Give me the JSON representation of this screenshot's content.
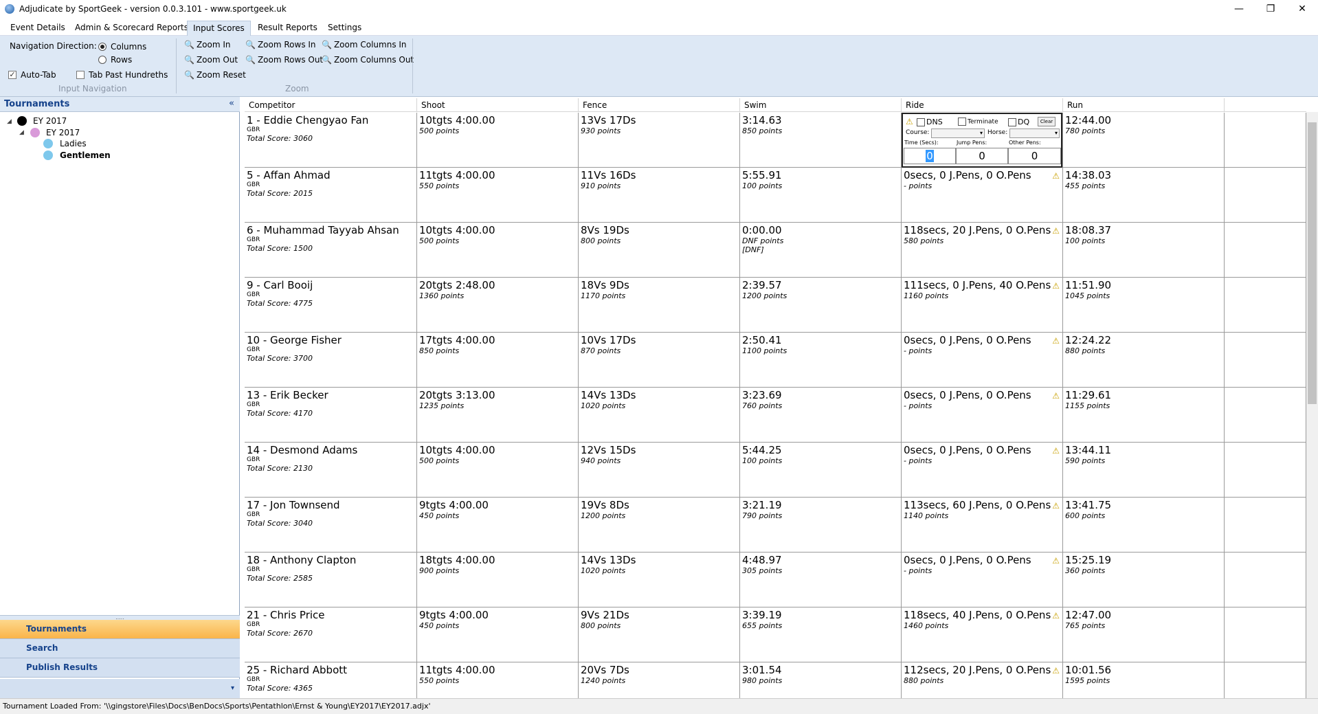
{
  "window": {
    "title": "Adjudicate by SportGeek - version 0.0.3.101 - www.sportgeek.uk",
    "minimize": "—",
    "restore": "❐",
    "close": "✕"
  },
  "menu": [
    "Event Details",
    "Admin & Scorecard Reports",
    "Input Scores",
    "Result Reports",
    "Settings"
  ],
  "ribbon": {
    "nav_direction_label": "Navigation Direction:",
    "columns": "Columns",
    "rows": "Rows",
    "auto_tab": "Auto-Tab",
    "tab_past": "Tab Past Hundreths",
    "group_nav": "Input Navigation",
    "zoom_in": "Zoom In",
    "zoom_out": "Zoom Out",
    "zoom_reset": "Zoom Reset",
    "zoom_rows_in": "Zoom Rows In",
    "zoom_rows_out": "Zoom Rows Out",
    "zoom_cols_in": "Zoom Columns In",
    "zoom_cols_out": "Zoom Columns Out",
    "group_zoom": "Zoom"
  },
  "panel": {
    "title": "Tournaments",
    "collapse": "«",
    "tree": {
      "root": "EY 2017",
      "child": "EY 2017",
      "ladies": "Ladies",
      "gentlemen": "Gentlemen"
    },
    "splitter": ".....",
    "nav": {
      "tournaments": "Tournaments",
      "search": "Search",
      "publish": "Publish Results"
    },
    "footer_arrow": "▾"
  },
  "grid": {
    "headers": [
      "Competitor",
      "Shoot",
      "Fence",
      "Swim",
      "Ride",
      "Run"
    ],
    "editor": {
      "dns": "DNS",
      "terminate": "Terminate",
      "dq": "DQ",
      "clear": "Clear",
      "course": "Course:",
      "horse": "Horse:",
      "time": "Time (Secs):",
      "jump": "Jump Pens:",
      "other": "Other Pens:",
      "time_val": "0",
      "jump_val": "0",
      "other_val": "0"
    },
    "rows": [
      {
        "name": "1 - Eddie Chengyao Fan",
        "nat": "GBR",
        "total": "Total Score: 3060",
        "shoot": "10tgts 4:00.00",
        "shoot_pts": "500 points",
        "fence": "13Vs 17Ds",
        "fence_pts": "930 points",
        "swim": "3:14.63",
        "swim_pts": "850 points",
        "swim_extra": "",
        "ride": "",
        "ride_pts": "",
        "run": "12:44.00",
        "run_pts": "780 points"
      },
      {
        "name": "5 - Affan Ahmad",
        "nat": "GBR",
        "total": "Total Score: 2015",
        "shoot": "11tgts 4:00.00",
        "shoot_pts": "550 points",
        "fence": "11Vs 16Ds",
        "fence_pts": "910 points",
        "swim": "5:55.91",
        "swim_pts": "100 points",
        "swim_extra": "",
        "ride": "0secs, 0 J.Pens, 0 O.Pens",
        "ride_pts": "- points",
        "run": "14:38.03",
        "run_pts": "455 points"
      },
      {
        "name": "6 - Muhammad Tayyab Ahsan",
        "nat": "GBR",
        "total": "Total Score: 1500",
        "shoot": "10tgts 4:00.00",
        "shoot_pts": "500 points",
        "fence": "8Vs 19Ds",
        "fence_pts": "800 points",
        "swim": "0:00.00",
        "swim_pts": "DNF points",
        "swim_extra": "[DNF]",
        "ride": "118secs, 20 J.Pens, 0 O.Pens",
        "ride_pts": "580 points",
        "run": "18:08.37",
        "run_pts": "100 points"
      },
      {
        "name": "9 - Carl Booij",
        "nat": "GBR",
        "total": "Total Score: 4775",
        "shoot": "20tgts 2:48.00",
        "shoot_pts": "1360 points",
        "fence": "18Vs 9Ds",
        "fence_pts": "1170 points",
        "swim": "2:39.57",
        "swim_pts": "1200 points",
        "swim_extra": "",
        "ride": "111secs, 0 J.Pens, 40 O.Pens",
        "ride_pts": "1160 points",
        "run": "11:51.90",
        "run_pts": "1045 points"
      },
      {
        "name": "10 - George Fisher",
        "nat": "GBR",
        "total": "Total Score: 3700",
        "shoot": "17tgts 4:00.00",
        "shoot_pts": "850 points",
        "fence": "10Vs 17Ds",
        "fence_pts": "870 points",
        "swim": "2:50.41",
        "swim_pts": "1100 points",
        "swim_extra": "",
        "ride": "0secs, 0 J.Pens, 0 O.Pens",
        "ride_pts": "- points",
        "run": "12:24.22",
        "run_pts": "880 points"
      },
      {
        "name": "13 - Erik Becker",
        "nat": "GBR",
        "total": "Total Score: 4170",
        "shoot": "20tgts 3:13.00",
        "shoot_pts": "1235 points",
        "fence": "14Vs 13Ds",
        "fence_pts": "1020 points",
        "swim": "3:23.69",
        "swim_pts": "760 points",
        "swim_extra": "",
        "ride": "0secs, 0 J.Pens, 0 O.Pens",
        "ride_pts": "- points",
        "run": "11:29.61",
        "run_pts": "1155 points"
      },
      {
        "name": "14 - Desmond Adams",
        "nat": "GBR",
        "total": "Total Score: 2130",
        "shoot": "10tgts 4:00.00",
        "shoot_pts": "500 points",
        "fence": "12Vs 15Ds",
        "fence_pts": "940 points",
        "swim": "5:44.25",
        "swim_pts": "100 points",
        "swim_extra": "",
        "ride": "0secs, 0 J.Pens, 0 O.Pens",
        "ride_pts": "- points",
        "run": "13:44.11",
        "run_pts": "590 points"
      },
      {
        "name": "17 - Jon Townsend",
        "nat": "GBR",
        "total": "Total Score: 3040",
        "shoot": "9tgts 4:00.00",
        "shoot_pts": "450 points",
        "fence": "19Vs 8Ds",
        "fence_pts": "1200 points",
        "swim": "3:21.19",
        "swim_pts": "790 points",
        "swim_extra": "",
        "ride": "113secs, 60 J.Pens, 0 O.Pens",
        "ride_pts": "1140 points",
        "run": "13:41.75",
        "run_pts": "600 points"
      },
      {
        "name": "18 - Anthony Clapton",
        "nat": "GBR",
        "total": "Total Score: 2585",
        "shoot": "18tgts 4:00.00",
        "shoot_pts": "900 points",
        "fence": "14Vs 13Ds",
        "fence_pts": "1020 points",
        "swim": "4:48.97",
        "swim_pts": "305 points",
        "swim_extra": "",
        "ride": "0secs, 0 J.Pens, 0 O.Pens",
        "ride_pts": "- points",
        "run": "15:25.19",
        "run_pts": "360 points"
      },
      {
        "name": "21 - Chris Price",
        "nat": "GBR",
        "total": "Total Score: 2670",
        "shoot": "9tgts 4:00.00",
        "shoot_pts": "450 points",
        "fence": "9Vs 21Ds",
        "fence_pts": "800 points",
        "swim": "3:39.19",
        "swim_pts": "655 points",
        "swim_extra": "",
        "ride": "118secs, 40 J.Pens, 0 O.Pens",
        "ride_pts": "1460 points",
        "run": "12:47.00",
        "run_pts": "765 points"
      },
      {
        "name": "25 - Richard Abbott",
        "nat": "GBR",
        "total": "Total Score: 4365",
        "shoot": "11tgts 4:00.00",
        "shoot_pts": "550 points",
        "fence": "20Vs 7Ds",
        "fence_pts": "1240 points",
        "swim": "3:01.54",
        "swim_pts": "980 points",
        "swim_extra": "",
        "ride": "112secs, 20 J.Pens, 0 O.Pens",
        "ride_pts": "880 points",
        "run": "10:01.56",
        "run_pts": "1595 points"
      }
    ]
  },
  "status": "Tournament Loaded From: '\\\\gingstore\\Files\\Docs\\BenDocs\\Sports\\Pentathlon\\Ernst & Young\\EY2017\\EY2017.adjx'",
  "colors": {
    "accent": "#15428b",
    "ribbon": "#dde8f5",
    "nav_active": "#f9b44a",
    "warning": "#c9a000"
  }
}
